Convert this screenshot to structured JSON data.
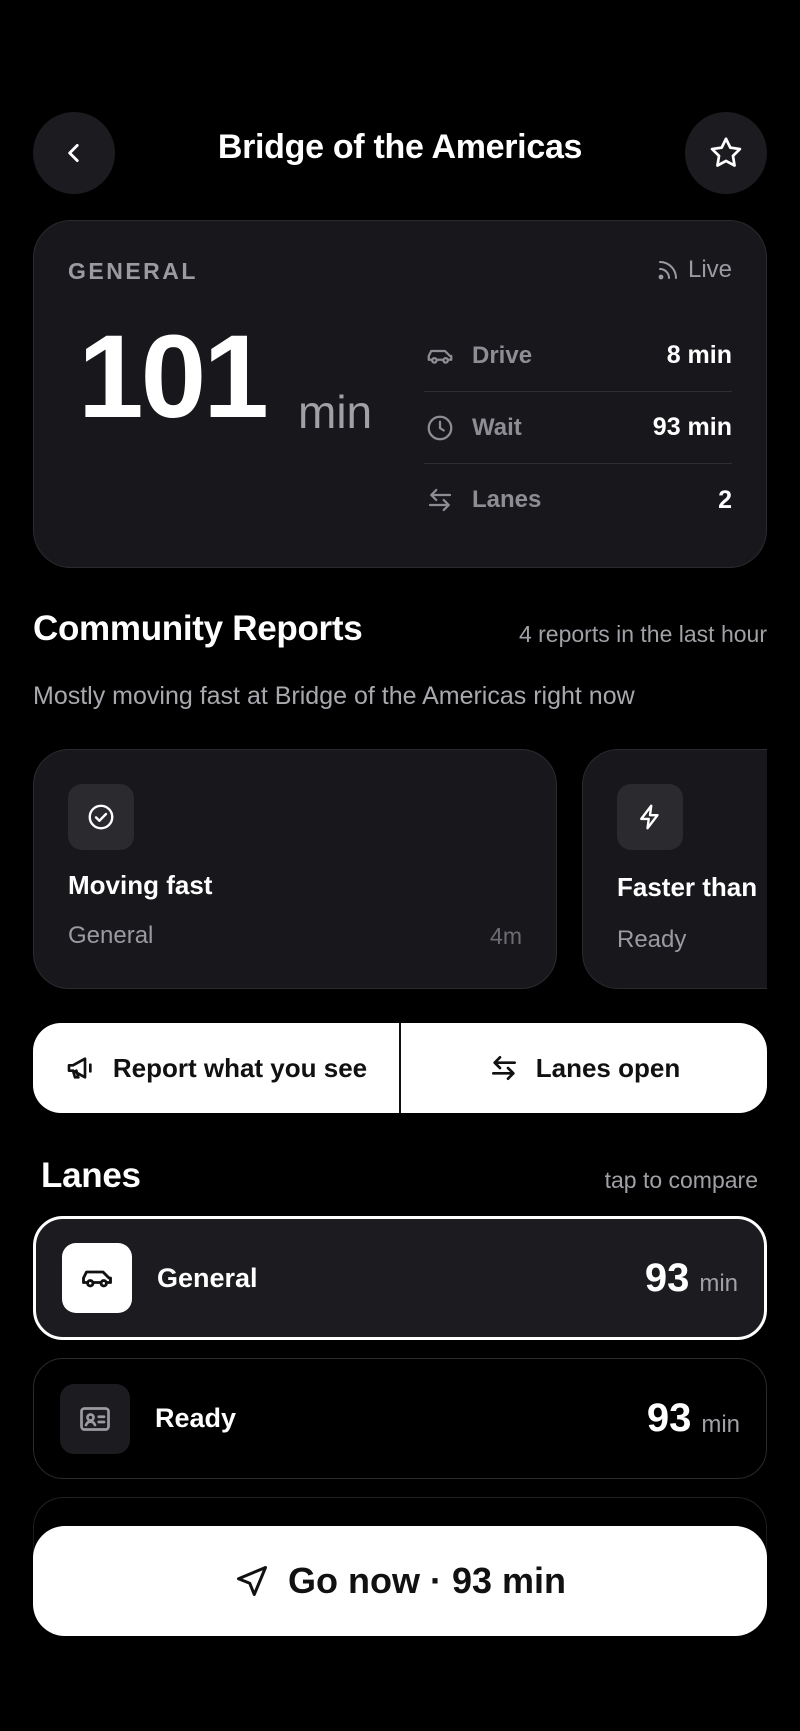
{
  "header": {
    "title": "Bridge of the Americas",
    "back_icon": "chevron-left-icon",
    "favorite_icon": "star-icon"
  },
  "summary": {
    "lane_type": "GENERAL",
    "live_label": "Live",
    "total_value": "101",
    "total_unit": "min",
    "stats": [
      {
        "icon": "car-icon",
        "label": "Drive",
        "value": "8 min"
      },
      {
        "icon": "clock-icon",
        "label": "Wait",
        "value": "93 min"
      },
      {
        "icon": "arrows-swap-icon",
        "label": "Lanes",
        "value": "2"
      }
    ]
  },
  "community": {
    "title": "Community Reports",
    "meta": "4 reports in the last hour",
    "subtitle": "Mostly moving fast at Bridge of the Americas right now",
    "reports": [
      {
        "icon": "check-circle-icon",
        "title": "Moving fast",
        "lane": "General",
        "age": "4m"
      },
      {
        "icon": "lightning-icon",
        "title": "Faster than",
        "lane": "Ready",
        "age": ""
      }
    ]
  },
  "actions": {
    "report_label": "Report what you see",
    "lanes_open_label": "Lanes open"
  },
  "lanes": {
    "title": "Lanes",
    "hint": "tap to compare",
    "items": [
      {
        "icon": "car-icon",
        "name": "General",
        "value": "93",
        "unit": "min",
        "selected": true
      },
      {
        "icon": "id-card-icon",
        "name": "Ready",
        "value": "93",
        "unit": "min",
        "selected": false
      }
    ]
  },
  "cta": {
    "label": "Go now · 93 min",
    "icon": "navigation-arrow-icon"
  },
  "colors": {
    "background": "#000000",
    "card": "#18181c",
    "muted_text": "#9a9aa0",
    "button": "#ffffff"
  }
}
